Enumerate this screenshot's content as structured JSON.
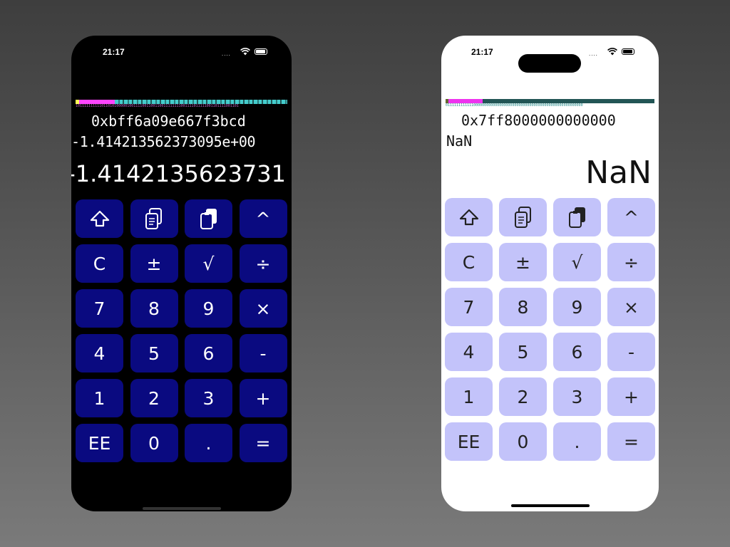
{
  "phones": [
    {
      "theme": "dark",
      "status": {
        "time": "21:17",
        "signal": "....",
        "accent": "#ffffff"
      },
      "bitbar_colors": {
        "sign": "#ffff55",
        "exponent": "#ff44ff",
        "mantissa": "#44cccc"
      },
      "bits": "1011111111110110101000001001111001100110011111111001111011111001101111001101",
      "hex": "0xbff6a09e667f3bcd",
      "scientific": "-1.414213562373095e+00",
      "display": "-1.4142135623731",
      "keys": [
        {
          "label": "",
          "icon": "shift-arrow-icon"
        },
        {
          "label": "",
          "icon": "copy-icon"
        },
        {
          "label": "",
          "icon": "paste-icon"
        },
        {
          "label": "^",
          "icon": ""
        },
        {
          "label": "C"
        },
        {
          "label": "±"
        },
        {
          "label": "√"
        },
        {
          "label": "÷"
        },
        {
          "label": "7"
        },
        {
          "label": "8"
        },
        {
          "label": "9"
        },
        {
          "label": "×"
        },
        {
          "label": "4"
        },
        {
          "label": "5"
        },
        {
          "label": "6"
        },
        {
          "label": "-"
        },
        {
          "label": "1"
        },
        {
          "label": "2"
        },
        {
          "label": "3"
        },
        {
          "label": "+"
        },
        {
          "label": "EE"
        },
        {
          "label": "0"
        },
        {
          "label": "."
        },
        {
          "label": "="
        }
      ],
      "colors": {
        "background": "#000000",
        "key": "#0a0a80",
        "key_text": "#ffffff"
      }
    },
    {
      "theme": "light",
      "status": {
        "time": "21:17",
        "signal": "....",
        "accent": "#000000"
      },
      "bitbar_colors": {
        "sign": "#666633",
        "exponent": "#ee33ee",
        "mantissa": "#225555"
      },
      "bits": "0111111111111000000000000000000000000000000000000000000000000000",
      "hex": "0x7ff8000000000000",
      "scientific": "NaN",
      "display": "NaN",
      "keys": [
        {
          "label": "",
          "icon": "shift-arrow-icon"
        },
        {
          "label": "",
          "icon": "copy-icon"
        },
        {
          "label": "",
          "icon": "paste-icon"
        },
        {
          "label": "^",
          "icon": ""
        },
        {
          "label": "C"
        },
        {
          "label": "±"
        },
        {
          "label": "√"
        },
        {
          "label": "÷"
        },
        {
          "label": "7"
        },
        {
          "label": "8"
        },
        {
          "label": "9"
        },
        {
          "label": "×"
        },
        {
          "label": "4"
        },
        {
          "label": "5"
        },
        {
          "label": "6"
        },
        {
          "label": "-"
        },
        {
          "label": "1"
        },
        {
          "label": "2"
        },
        {
          "label": "3"
        },
        {
          "label": "+"
        },
        {
          "label": "EE"
        },
        {
          "label": "0"
        },
        {
          "label": "."
        },
        {
          "label": "="
        }
      ],
      "colors": {
        "background": "#ffffff",
        "key": "#c3c3fa",
        "key_text": "#222222"
      }
    }
  ]
}
